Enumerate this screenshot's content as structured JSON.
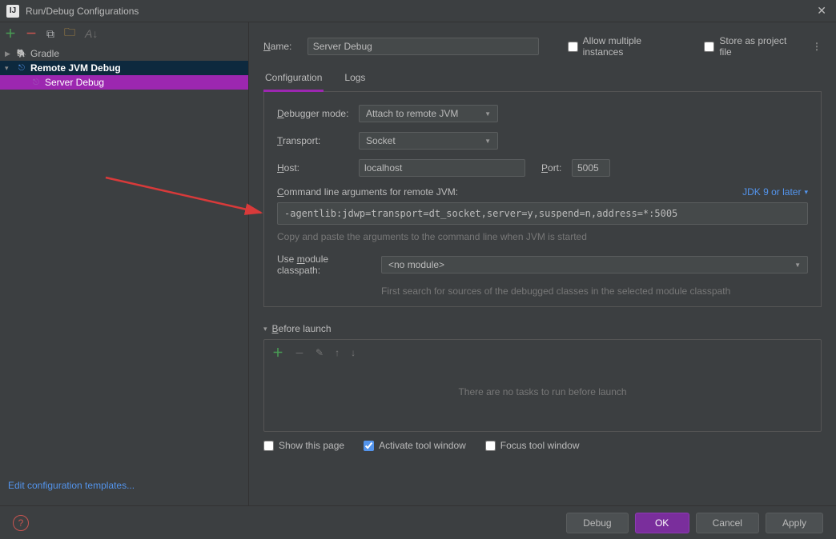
{
  "window": {
    "title": "Run/Debug Configurations"
  },
  "tree": {
    "gradle": "Gradle",
    "remote": "Remote JVM Debug",
    "server": "Server Debug"
  },
  "sidebar_link": "Edit configuration templates...",
  "header": {
    "name_label": "Name:",
    "name_value": "Server Debug",
    "allow_multiple": "Allow multiple instances",
    "store_as": "Store as project file"
  },
  "tabs": {
    "config": "Configuration",
    "logs": "Logs"
  },
  "form": {
    "debugger_mode_label": "Debugger mode:",
    "debugger_mode_value": "Attach to remote JVM",
    "transport_label": "Transport:",
    "transport_value": "Socket",
    "host_label": "Host:",
    "host_value": "localhost",
    "port_label": "Port:",
    "port_value": "5005",
    "cmd_label": "Command line arguments for remote JVM:",
    "jdk_link": "JDK 9 or later",
    "cmd_value": "-agentlib:jdwp=transport=dt_socket,server=y,suspend=n,address=*:5005",
    "cmd_hint": "Copy and paste the arguments to the command line when JVM is started",
    "module_label": "Use module classpath:",
    "module_value": "<no module>",
    "module_hint": "First search for sources of the debugged classes in the selected module classpath"
  },
  "before_launch": {
    "title": "Before launch",
    "empty": "There are no tasks to run before launch",
    "show_page": "Show this page",
    "activate": "Activate tool window",
    "focus": "Focus tool window"
  },
  "buttons": {
    "debug": "Debug",
    "ok": "OK",
    "cancel": "Cancel",
    "apply": "Apply"
  }
}
